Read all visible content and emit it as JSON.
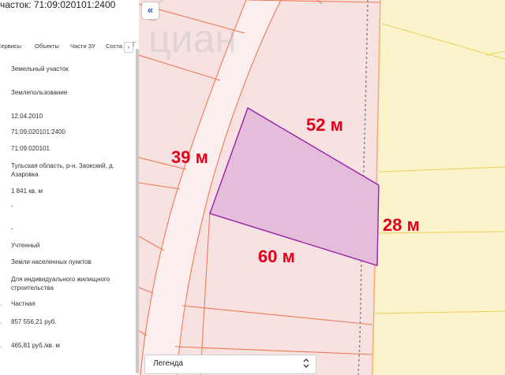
{
  "panel": {
    "title": "участок: 71:09:020101:2400",
    "tabs": [
      "Сервисы",
      "Объекты",
      "Части ЗУ",
      "Соста"
    ],
    "tab_arrow": "›",
    "tab_next": "Г",
    "fields": [
      "Земельный участок",
      "Землепользование",
      "12.04.2010",
      "71:09:020101:2400",
      "71:09:020101",
      "Тульская область, р-н. Заокский, д. Азаровка",
      "1 841 кв. м",
      "-",
      "-",
      "Учтенный",
      "Земли населенных пунктов",
      "Для индивидуального жилищного строительства",
      "Частная",
      "857 556,21 руб.",
      "465,81 руб./кв. м"
    ],
    "bullets": [
      ".",
      ".",
      ".",
      "."
    ]
  },
  "map": {
    "collapse_icon": "«",
    "legend_label": "Легенда",
    "legend_icon": "⌃⌄",
    "dimensions": {
      "top": "52 м",
      "left": "39 м",
      "right": "28 м",
      "bottom": "60 м"
    },
    "watermark": "циан"
  },
  "colors": {
    "parcel_fill": "#e4bddb",
    "parcel_stroke": "#9b20a8",
    "zone_left": "#f7e1e1",
    "zone_right": "#faf3cc",
    "boundary": "#f07a55",
    "label_red": "#e3001b"
  }
}
